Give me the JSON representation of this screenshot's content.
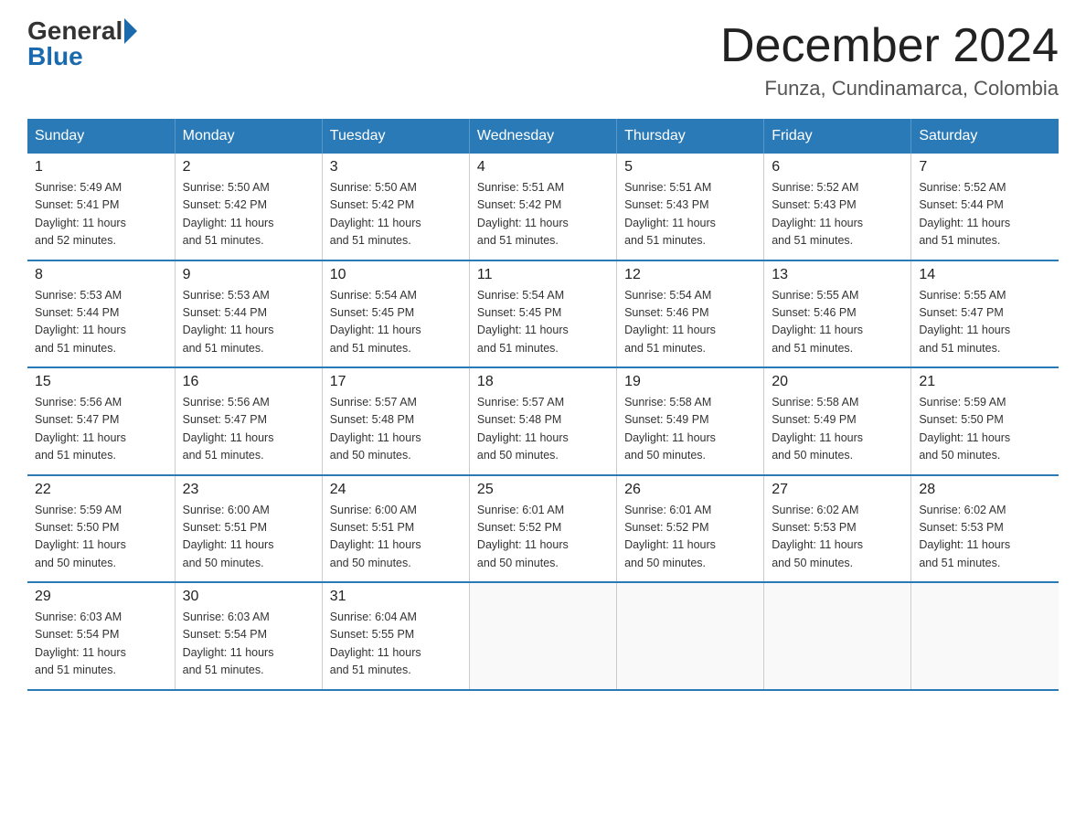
{
  "logo": {
    "general": "General",
    "blue": "Blue"
  },
  "header": {
    "month": "December 2024",
    "location": "Funza, Cundinamarca, Colombia"
  },
  "weekdays": [
    "Sunday",
    "Monday",
    "Tuesday",
    "Wednesday",
    "Thursday",
    "Friday",
    "Saturday"
  ],
  "weeks": [
    [
      {
        "day": "1",
        "sunrise": "5:49 AM",
        "sunset": "5:41 PM",
        "daylight": "11 hours and 52 minutes."
      },
      {
        "day": "2",
        "sunrise": "5:50 AM",
        "sunset": "5:42 PM",
        "daylight": "11 hours and 51 minutes."
      },
      {
        "day": "3",
        "sunrise": "5:50 AM",
        "sunset": "5:42 PM",
        "daylight": "11 hours and 51 minutes."
      },
      {
        "day": "4",
        "sunrise": "5:51 AM",
        "sunset": "5:42 PM",
        "daylight": "11 hours and 51 minutes."
      },
      {
        "day": "5",
        "sunrise": "5:51 AM",
        "sunset": "5:43 PM",
        "daylight": "11 hours and 51 minutes."
      },
      {
        "day": "6",
        "sunrise": "5:52 AM",
        "sunset": "5:43 PM",
        "daylight": "11 hours and 51 minutes."
      },
      {
        "day": "7",
        "sunrise": "5:52 AM",
        "sunset": "5:44 PM",
        "daylight": "11 hours and 51 minutes."
      }
    ],
    [
      {
        "day": "8",
        "sunrise": "5:53 AM",
        "sunset": "5:44 PM",
        "daylight": "11 hours and 51 minutes."
      },
      {
        "day": "9",
        "sunrise": "5:53 AM",
        "sunset": "5:44 PM",
        "daylight": "11 hours and 51 minutes."
      },
      {
        "day": "10",
        "sunrise": "5:54 AM",
        "sunset": "5:45 PM",
        "daylight": "11 hours and 51 minutes."
      },
      {
        "day": "11",
        "sunrise": "5:54 AM",
        "sunset": "5:45 PM",
        "daylight": "11 hours and 51 minutes."
      },
      {
        "day": "12",
        "sunrise": "5:54 AM",
        "sunset": "5:46 PM",
        "daylight": "11 hours and 51 minutes."
      },
      {
        "day": "13",
        "sunrise": "5:55 AM",
        "sunset": "5:46 PM",
        "daylight": "11 hours and 51 minutes."
      },
      {
        "day": "14",
        "sunrise": "5:55 AM",
        "sunset": "5:47 PM",
        "daylight": "11 hours and 51 minutes."
      }
    ],
    [
      {
        "day": "15",
        "sunrise": "5:56 AM",
        "sunset": "5:47 PM",
        "daylight": "11 hours and 51 minutes."
      },
      {
        "day": "16",
        "sunrise": "5:56 AM",
        "sunset": "5:47 PM",
        "daylight": "11 hours and 51 minutes."
      },
      {
        "day": "17",
        "sunrise": "5:57 AM",
        "sunset": "5:48 PM",
        "daylight": "11 hours and 50 minutes."
      },
      {
        "day": "18",
        "sunrise": "5:57 AM",
        "sunset": "5:48 PM",
        "daylight": "11 hours and 50 minutes."
      },
      {
        "day": "19",
        "sunrise": "5:58 AM",
        "sunset": "5:49 PM",
        "daylight": "11 hours and 50 minutes."
      },
      {
        "day": "20",
        "sunrise": "5:58 AM",
        "sunset": "5:49 PM",
        "daylight": "11 hours and 50 minutes."
      },
      {
        "day": "21",
        "sunrise": "5:59 AM",
        "sunset": "5:50 PM",
        "daylight": "11 hours and 50 minutes."
      }
    ],
    [
      {
        "day": "22",
        "sunrise": "5:59 AM",
        "sunset": "5:50 PM",
        "daylight": "11 hours and 50 minutes."
      },
      {
        "day": "23",
        "sunrise": "6:00 AM",
        "sunset": "5:51 PM",
        "daylight": "11 hours and 50 minutes."
      },
      {
        "day": "24",
        "sunrise": "6:00 AM",
        "sunset": "5:51 PM",
        "daylight": "11 hours and 50 minutes."
      },
      {
        "day": "25",
        "sunrise": "6:01 AM",
        "sunset": "5:52 PM",
        "daylight": "11 hours and 50 minutes."
      },
      {
        "day": "26",
        "sunrise": "6:01 AM",
        "sunset": "5:52 PM",
        "daylight": "11 hours and 50 minutes."
      },
      {
        "day": "27",
        "sunrise": "6:02 AM",
        "sunset": "5:53 PM",
        "daylight": "11 hours and 50 minutes."
      },
      {
        "day": "28",
        "sunrise": "6:02 AM",
        "sunset": "5:53 PM",
        "daylight": "11 hours and 51 minutes."
      }
    ],
    [
      {
        "day": "29",
        "sunrise": "6:03 AM",
        "sunset": "5:54 PM",
        "daylight": "11 hours and 51 minutes."
      },
      {
        "day": "30",
        "sunrise": "6:03 AM",
        "sunset": "5:54 PM",
        "daylight": "11 hours and 51 minutes."
      },
      {
        "day": "31",
        "sunrise": "6:04 AM",
        "sunset": "5:55 PM",
        "daylight": "11 hours and 51 minutes."
      },
      null,
      null,
      null,
      null
    ]
  ],
  "labels": {
    "sunrise": "Sunrise:",
    "sunset": "Sunset:",
    "daylight": "Daylight:"
  }
}
